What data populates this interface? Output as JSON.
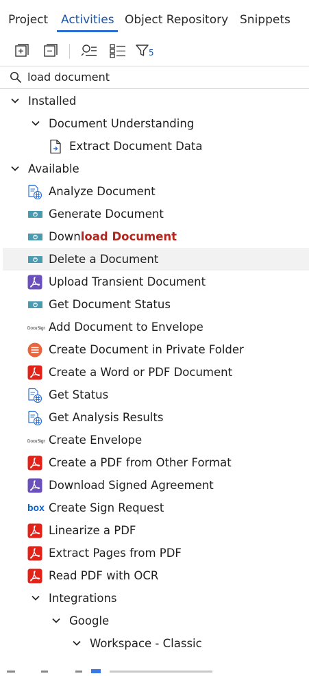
{
  "tabs": [
    {
      "label": "Project"
    },
    {
      "label": "Activities"
    },
    {
      "label": "Object Repository"
    },
    {
      "label": "Snippets"
    }
  ],
  "toolbar": {
    "filter_count": "5"
  },
  "search": {
    "value": "load document"
  },
  "colors": {
    "accent": "#1a56a8",
    "match": "#b3261e",
    "pdf_red": "#e2231a",
    "purple": "#6b4fbb",
    "teal": "#4a9ab0"
  },
  "tree": {
    "installed": {
      "label": "Installed",
      "group": "Document Understanding",
      "item": {
        "label": "Extract Document Data",
        "icon": "document-arrow-icon"
      }
    },
    "available": {
      "label": "Available",
      "items": [
        {
          "pre": "Analyze Document",
          "match": "",
          "post": "",
          "icon": "document-table-icon"
        },
        {
          "pre": "Generate Document",
          "match": "",
          "post": "",
          "icon": "teal-connector-icon"
        },
        {
          "pre": "Down",
          "match": "load Document",
          "post": "",
          "icon": "teal-connector-icon"
        },
        {
          "pre": "Delete a Document",
          "match": "",
          "post": "",
          "icon": "teal-connector-icon"
        },
        {
          "pre": "Upload Transient Document",
          "match": "",
          "post": "",
          "icon": "acrobat-sign-icon"
        },
        {
          "pre": "Get Document Status",
          "match": "",
          "post": "",
          "icon": "teal-connector-icon"
        },
        {
          "pre": "Add Document to Envelope",
          "match": "",
          "post": "",
          "icon": "docusign-icon"
        },
        {
          "pre": "Create Document in Private Folder",
          "match": "",
          "post": "",
          "icon": "orange-circle-icon"
        },
        {
          "pre": "Create a Word or PDF Document",
          "match": "",
          "post": "",
          "icon": "acrobat-icon"
        },
        {
          "pre": "Get Status",
          "match": "",
          "post": "",
          "icon": "document-table-icon"
        },
        {
          "pre": "Get Analysis Results",
          "match": "",
          "post": "",
          "icon": "document-table-icon"
        },
        {
          "pre": "Create Envelope",
          "match": "",
          "post": "",
          "icon": "docusign-icon"
        },
        {
          "pre": "Create a PDF from Other Format",
          "match": "",
          "post": "",
          "icon": "acrobat-icon"
        },
        {
          "pre": "Download Signed Agreement",
          "match": "",
          "post": "",
          "icon": "acrobat-sign-icon"
        },
        {
          "pre": "Create Sign Request",
          "match": "",
          "post": "",
          "icon": "box-icon"
        },
        {
          "pre": "Linearize a PDF",
          "match": "",
          "post": "",
          "icon": "acrobat-icon"
        },
        {
          "pre": "Extract Pages from PDF",
          "match": "",
          "post": "",
          "icon": "acrobat-icon"
        },
        {
          "pre": "Read PDF with OCR",
          "match": "",
          "post": "",
          "icon": "acrobat-icon"
        }
      ],
      "integrations": {
        "label": "Integrations",
        "google": "Google",
        "workspace": "Workspace - Classic"
      }
    },
    "docusign_text": "DocuSign",
    "box_text": "box"
  }
}
